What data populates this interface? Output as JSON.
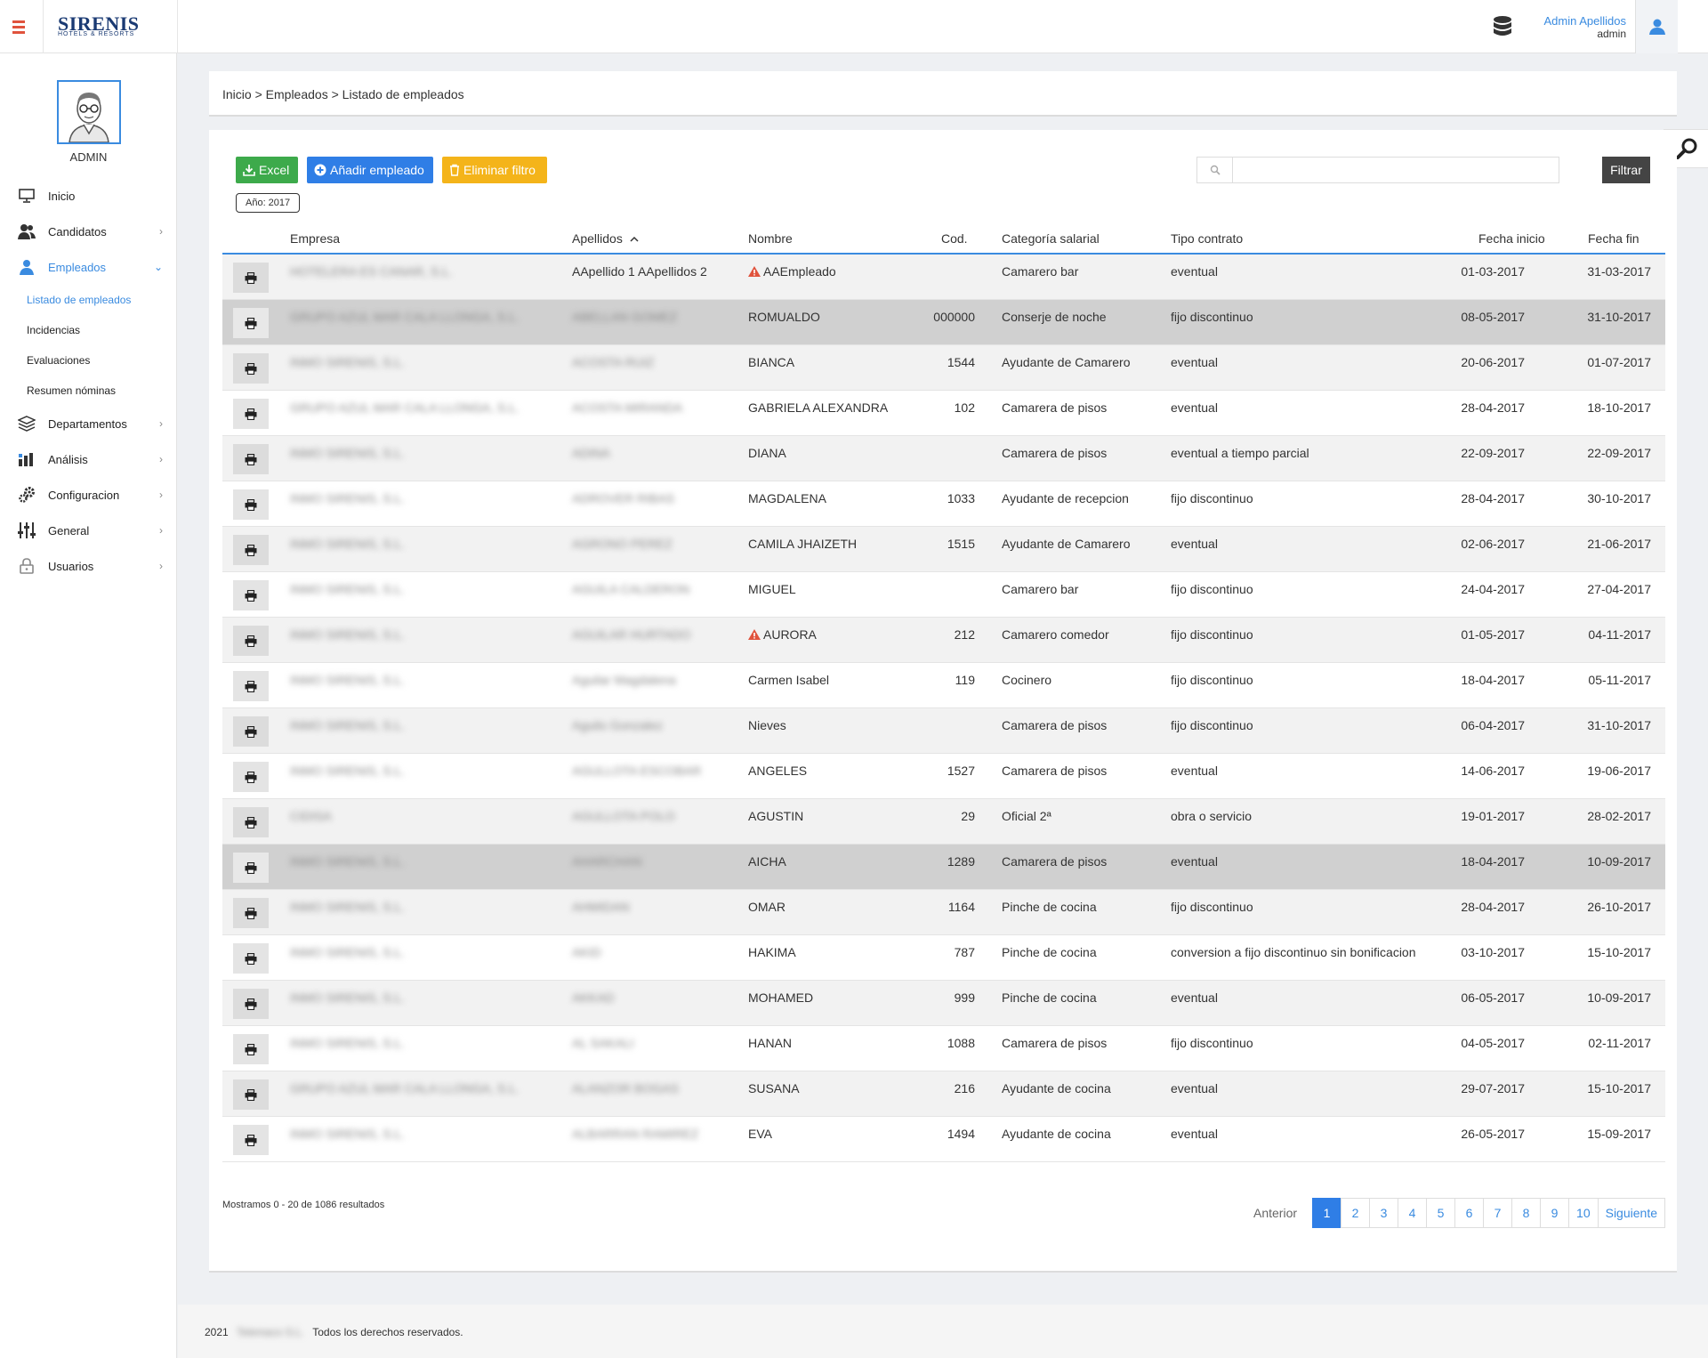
{
  "header": {
    "logo": "SIRENIS",
    "logo_sub": "HOTELS & RESORTS",
    "user_name": "Admin Apellidos",
    "user_role": "admin"
  },
  "sidebar": {
    "profile_label": "ADMIN",
    "items": [
      {
        "label": "Inicio",
        "icon": "monitor-icon"
      },
      {
        "label": "Candidatos",
        "icon": "users-icon"
      },
      {
        "label": "Empleados",
        "icon": "user-icon",
        "active": true
      },
      {
        "label": "Departamentos",
        "icon": "layers-icon"
      },
      {
        "label": "Análisis",
        "icon": "bar-chart-icon"
      },
      {
        "label": "Configuracion",
        "icon": "gears-icon"
      },
      {
        "label": "General",
        "icon": "sliders-icon"
      },
      {
        "label": "Usuarios",
        "icon": "lock-icon"
      }
    ],
    "sub_items": [
      {
        "label": "Listado de empleados",
        "active": true
      },
      {
        "label": "Incidencias"
      },
      {
        "label": "Evaluaciones"
      },
      {
        "label": "Resumen nóminas"
      }
    ]
  },
  "breadcrumb": {
    "home": "Inicio",
    "section": "Empleados",
    "current": "Listado de empleados",
    "separator": ">"
  },
  "toolbar": {
    "excel_label": "Excel",
    "add_label": "Añadir empleado",
    "remove_filter_label": "Eliminar filtro",
    "year_filter": "Año: 2017",
    "search_value": "",
    "filter_label": "Filtrar"
  },
  "colors": {
    "accent": "#3a8be0",
    "excel": "#3daa4b",
    "add": "#2f7ee6",
    "remove_filter": "#f4b41a",
    "warning": "#e0533d"
  },
  "table": {
    "headers": {
      "empresa": "Empresa",
      "apellidos": "Apellidos",
      "nombre": "Nombre",
      "cod": "Cod.",
      "categoria": "Categoría salarial",
      "tipo": "Tipo contrato",
      "inicio": "Fecha inicio",
      "fin": "Fecha fin"
    },
    "sort_column": "apellidos",
    "sort_direction": "asc",
    "rows": [
      {
        "empresa": "HOTELERA ES CANAR, S.L.",
        "apellidos": "AApellido 1 AApellidos 2",
        "apellidos_blur": false,
        "nombre": "AAEmpleado",
        "warn": true,
        "cod": "",
        "categoria": "Camarero bar",
        "tipo": "eventual",
        "inicio": "01-03-2017",
        "fin": "31-03-2017"
      },
      {
        "empresa": "GRUPO AZUL MAR CALA LLONGA, S.L.",
        "apellidos": "ABELLAN GOMEZ",
        "apellidos_blur": true,
        "nombre": "ROMUALDO",
        "warn": false,
        "cod": "000000",
        "categoria": "Conserje de noche",
        "tipo": "fijo discontinuo",
        "inicio": "08-05-2017",
        "fin": "31-10-2017",
        "selected": true
      },
      {
        "empresa": "INMO SIRENIS, S.L.",
        "apellidos": "ACOSTA RUIZ",
        "apellidos_blur": true,
        "nombre": "BIANCA",
        "warn": false,
        "cod": "1544",
        "categoria": "Ayudante de Camarero",
        "tipo": "eventual",
        "inicio": "20-06-2017",
        "fin": "01-07-2017"
      },
      {
        "empresa": "GRUPO AZUL MAR CALA LLONGA, S.L.",
        "apellidos": "ACOSTA MIRANDA",
        "apellidos_blur": true,
        "nombre": "GABRIELA ALEXANDRA",
        "warn": false,
        "cod": "102",
        "categoria": "Camarera de pisos",
        "tipo": "eventual",
        "inicio": "28-04-2017",
        "fin": "18-10-2017"
      },
      {
        "empresa": "INMO SIRENIS, S.L.",
        "apellidos": "ADINA",
        "apellidos_blur": true,
        "nombre": "DIANA",
        "warn": false,
        "cod": "",
        "categoria": "Camarera de pisos",
        "tipo": "eventual a tiempo parcial",
        "inicio": "22-09-2017",
        "fin": "22-09-2017"
      },
      {
        "empresa": "INMO SIRENIS, S.L.",
        "apellidos": "ADROVER RIBAS",
        "apellidos_blur": true,
        "nombre": "MAGDALENA",
        "warn": false,
        "cod": "1033",
        "categoria": "Ayudante de recepcion",
        "tipo": "fijo discontinuo",
        "inicio": "28-04-2017",
        "fin": "30-10-2017"
      },
      {
        "empresa": "INMO SIRENIS, S.L.",
        "apellidos": "AGRONO PEREZ",
        "apellidos_blur": true,
        "nombre": "CAMILA JHAIZETH",
        "warn": false,
        "cod": "1515",
        "categoria": "Ayudante de Camarero",
        "tipo": "eventual",
        "inicio": "02-06-2017",
        "fin": "21-06-2017"
      },
      {
        "empresa": "INMO SIRENIS, S.L.",
        "apellidos": "AGUILA CALDERON",
        "apellidos_blur": true,
        "nombre": "MIGUEL",
        "warn": false,
        "cod": "",
        "categoria": "Camarero bar",
        "tipo": "fijo discontinuo",
        "inicio": "24-04-2017",
        "fin": "27-04-2017"
      },
      {
        "empresa": "INMO SIRENIS, S.L.",
        "apellidos": "AGUILAR HURTADO",
        "apellidos_blur": true,
        "nombre": "AURORA",
        "warn": true,
        "cod": "212",
        "categoria": "Camarero comedor",
        "tipo": "fijo discontinuo",
        "inicio": "01-05-2017",
        "fin": "04-11-2017"
      },
      {
        "empresa": "INMO SIRENIS, S.L.",
        "apellidos": "Aguilar Magdalena",
        "apellidos_blur": true,
        "nombre": "Carmen Isabel",
        "warn": false,
        "cod": "119",
        "categoria": "Cocinero",
        "tipo": "fijo discontinuo",
        "inicio": "18-04-2017",
        "fin": "05-11-2017"
      },
      {
        "empresa": "INMO SIRENIS, S.L.",
        "apellidos": "Aguilo Gonzalez",
        "apellidos_blur": true,
        "nombre": "Nieves",
        "warn": false,
        "cod": "",
        "categoria": "Camarera de pisos",
        "tipo": "fijo discontinuo",
        "inicio": "06-04-2017",
        "fin": "31-10-2017"
      },
      {
        "empresa": "INMO SIRENIS, S.L.",
        "apellidos": "AGULLOTA ESCOBAR",
        "apellidos_blur": true,
        "nombre": "ANGELES",
        "warn": false,
        "cod": "1527",
        "categoria": "Camarera de pisos",
        "tipo": "eventual",
        "inicio": "14-06-2017",
        "fin": "19-06-2017"
      },
      {
        "empresa": "CIDISA",
        "apellidos": "AGULLOTA POLO",
        "apellidos_blur": true,
        "nombre": "AGUSTIN",
        "warn": false,
        "cod": "29",
        "categoria": "Oficial 2ª",
        "tipo": "obra o servicio",
        "inicio": "19-01-2017",
        "fin": "28-02-2017"
      },
      {
        "empresa": "INMO SIRENIS, S.L.",
        "apellidos": "AHARCHAN",
        "apellidos_blur": true,
        "nombre": "AICHA",
        "warn": false,
        "cod": "1289",
        "categoria": "Camarera de pisos",
        "tipo": "eventual",
        "inicio": "18-04-2017",
        "fin": "10-09-2017",
        "selected": true
      },
      {
        "empresa": "INMO SIRENIS, S.L.",
        "apellidos": "AHMIDAN",
        "apellidos_blur": true,
        "nombre": "OMAR",
        "warn": false,
        "cod": "1164",
        "categoria": "Pinche de cocina",
        "tipo": "fijo discontinuo",
        "inicio": "28-04-2017",
        "fin": "26-10-2017"
      },
      {
        "empresa": "INMO SIRENIS, S.L.",
        "apellidos": "AKID",
        "apellidos_blur": true,
        "nombre": "HAKIMA",
        "warn": false,
        "cod": "787",
        "categoria": "Pinche de cocina",
        "tipo": "conversion a fijo discontinuo sin bonificacion",
        "inicio": "03-10-2017",
        "fin": "15-10-2017"
      },
      {
        "empresa": "INMO SIRENIS, S.L.",
        "apellidos": "AKKAD",
        "apellidos_blur": true,
        "nombre": "MOHAMED",
        "warn": false,
        "cod": "999",
        "categoria": "Pinche de cocina",
        "tipo": "eventual",
        "inicio": "06-05-2017",
        "fin": "10-09-2017"
      },
      {
        "empresa": "INMO SIRENIS, S.L.",
        "apellidos": "AL SAKALI",
        "apellidos_blur": true,
        "nombre": "HANAN",
        "warn": false,
        "cod": "1088",
        "categoria": "Camarera de pisos",
        "tipo": "fijo discontinuo",
        "inicio": "04-05-2017",
        "fin": "02-11-2017"
      },
      {
        "empresa": "GRUPO AZUL MAR CALA LLONGA, S.L.",
        "apellidos": "ALANZOR BOGAS",
        "apellidos_blur": true,
        "nombre": "SUSANA",
        "warn": false,
        "cod": "216",
        "categoria": "Ayudante de cocina",
        "tipo": "eventual",
        "inicio": "29-07-2017",
        "fin": "15-10-2017"
      },
      {
        "empresa": "INMO SIRENIS, S.L.",
        "apellidos": "ALBARRAN RAMIREZ",
        "apellidos_blur": true,
        "nombre": "EVA",
        "warn": false,
        "cod": "1494",
        "categoria": "Ayudante de cocina",
        "tipo": "eventual",
        "inicio": "26-05-2017",
        "fin": "15-09-2017"
      }
    ]
  },
  "results_text": "Mostramos 0 - 20 de 1086 resultados",
  "pagination": {
    "prev": "Anterior",
    "next": "Siguiente",
    "pages": [
      "1",
      "2",
      "3",
      "4",
      "5",
      "6",
      "7",
      "8",
      "9",
      "10"
    ],
    "current": "1"
  },
  "footer": {
    "year": "2021",
    "company": "Telemaco S.L.",
    "rights": "Todos los derechos reservados."
  }
}
